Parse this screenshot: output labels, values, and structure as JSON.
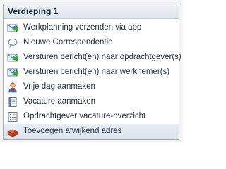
{
  "menu": {
    "header": "Verdieping 1",
    "items": [
      {
        "label": "Werkplanning verzenden via app",
        "icon": "send-mail-icon"
      },
      {
        "label": "Nieuwe Correspondentie",
        "icon": "speech-bubble-icon"
      },
      {
        "label": "Versturen bericht(en) naar opdrachtgever(s)",
        "icon": "send-mail-icon"
      },
      {
        "label": "Versturen bericht(en) naar werknemer(s)",
        "icon": "send-mail-icon"
      },
      {
        "label": "Vrije dag aanmaken",
        "icon": "person-icon"
      },
      {
        "label": "Vacature aanmaken",
        "icon": "document-icon"
      },
      {
        "label": "Opdrachtgever vacature-overzicht",
        "icon": "list-icon"
      },
      {
        "label": "Toevoegen afwijkend adres",
        "icon": "brick-icon"
      }
    ]
  },
  "colors": {
    "header_text": "#15283d",
    "item_text": "#1e2f44",
    "hover_bg": "#dbe3ee",
    "border": "#a7abb0"
  }
}
